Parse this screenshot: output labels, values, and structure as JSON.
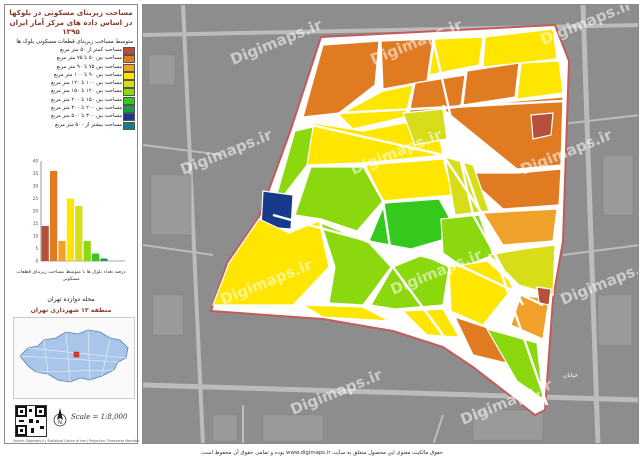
{
  "panel": {
    "title_line1": "مساحت زیربنای مسکونی در بلوکها",
    "title_line2": "در اساس داده های مرکز آمار ایران ۱۳۹۵",
    "legend_heading": "متوسط مساحت زیربنای قطعات مسکونی بلوک ها",
    "legend": [
      {
        "label": "مساحت کمتر از ۵۰ متر مربع",
        "color": "#b5503c"
      },
      {
        "label": "مساحت بین ۵۰ تا ۷۵ متر مربع",
        "color": "#e07b22"
      },
      {
        "label": "مساحت بین ۷۵ تا ۹۰ متر مربع",
        "color": "#f0a12a"
      },
      {
        "label": "مساحت بین ۹۰ تا ۱۰۰ متر مربع",
        "color": "#ffe600"
      },
      {
        "label": "مساحت بین ۱۰۰ تا ۱۲۰ متر مربع",
        "color": "#d8dd1a"
      },
      {
        "label": "مساحت بین ۱۲۰ تا ۱۵۰ متر مربع",
        "color": "#8ad80d"
      },
      {
        "label": "مساحت بین ۱۵۰ تا ۲۰۰ متر مربع",
        "color": "#35c81d"
      },
      {
        "label": "مساحت بین ۲۰۰ تا ۳۰۰ متر مربع",
        "color": "#1f9a46"
      },
      {
        "label": "مساحت بین ۳۰۰ تا ۵۰۰ متر مربع",
        "color": "#183a8a"
      },
      {
        "label": "مساحت بیشتر از ۵۰۰ متر مربع",
        "color": "#1a7b8a"
      }
    ],
    "chart_caption": "درصد تعداد بلوک ها با متوسط مساحت زیربنای قطعات مسکونی",
    "region_line1": "محله دوازده تهران",
    "region_line2": "منطقه ۱۲ شهرداری تهران",
    "scale_text": "Scale = 1:8,000",
    "credit": "Source: Digimaps.ir | Statistical Centre of Iran | Projection: Transverse Mercator"
  },
  "chart_data": {
    "type": "bar",
    "categories": [
      "<50",
      "50-75",
      "75-90",
      "90-100",
      "100-120",
      "120-150",
      "150-200",
      "200-300",
      "300-500",
      ">500"
    ],
    "values": [
      14,
      36,
      8,
      25,
      22,
      8,
      3,
      1,
      0,
      0
    ],
    "ylim": [
      0,
      40
    ],
    "yticks": [
      0,
      5,
      10,
      15,
      20,
      25,
      30,
      35,
      40
    ],
    "colors": [
      "#b5503c",
      "#e07b22",
      "#f0a12a",
      "#ffe600",
      "#d8dd1a",
      "#8ad80d",
      "#35c81d",
      "#1f9a46",
      "#183a8a",
      "#1a7b8a"
    ]
  },
  "map": {
    "watermark": "Digimaps.ir",
    "label_street": "خیابان"
  },
  "footer": "حقوق مالکیت معنوی این محصول متعلق به سایت www.digimaps.ir بوده و تمامی حقوق آن محفوظ است."
}
